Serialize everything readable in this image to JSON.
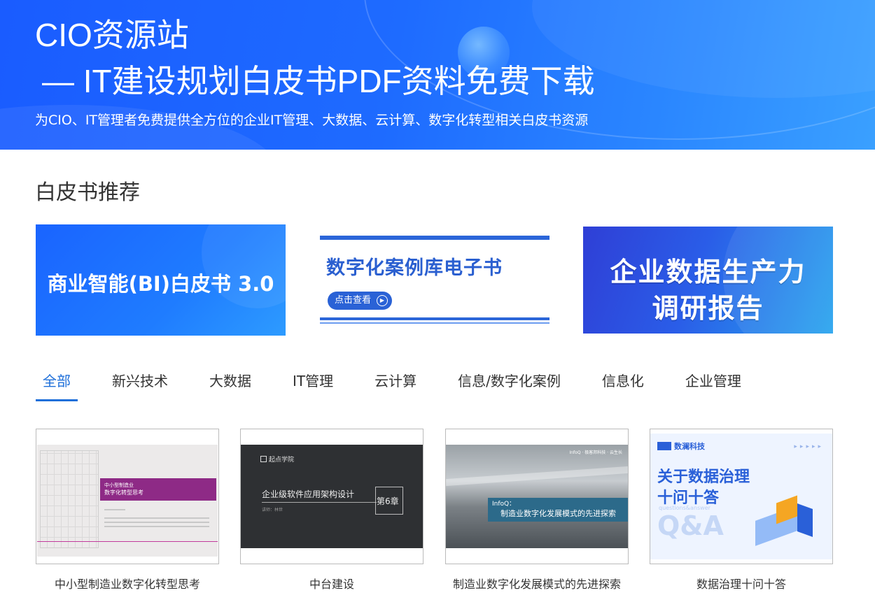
{
  "header": {
    "title_line1": "CIO资源站",
    "title_line2": "— IT建设规划白皮书PDF资料免费下载",
    "subtitle": "为CIO、IT管理者免费提供全方位的企业IT管理、大数据、云计算、数字化转型相关白皮书资源"
  },
  "section": {
    "title": "白皮书推荐"
  },
  "banners": [
    {
      "text": "商业智能(BI)白皮书 3.0"
    },
    {
      "text": "数字化案例库电子书",
      "button": "点击查看",
      "button_icon": "play-circle-icon"
    },
    {
      "line1": "企业数据生产力",
      "line2": "调研报告"
    }
  ],
  "tabs": [
    {
      "label": "全部",
      "active": true
    },
    {
      "label": "新兴技术"
    },
    {
      "label": "大数据"
    },
    {
      "label": "IT管理"
    },
    {
      "label": "云计算"
    },
    {
      "label": "信息/数字化案例"
    },
    {
      "label": "信息化"
    },
    {
      "label": "企业管理"
    }
  ],
  "cards": [
    {
      "caption": "中小型制造业数字化转型思考",
      "cover": {
        "small": "中小型制造业",
        "title": "数字化转型思考"
      }
    },
    {
      "caption": "中台建设",
      "cover": {
        "logo": "起点学院",
        "title": "企业级软件应用架构设计",
        "chapter": "第6章",
        "meta": "讲师：林世"
      }
    },
    {
      "caption": "制造业数字化发展模式的先进探索",
      "cover": {
        "kicker": "InfoQ：",
        "title": "制造业数字化发展模式的先进探索",
        "tag": "InfoQ · 极客邦科技 · 云生长"
      }
    },
    {
      "caption": "数据治理十问十答",
      "cover": {
        "brand": "数澜科技",
        "line1": "关于数据治理",
        "line2": "十问十答",
        "small": "questions&answer",
        "big": "Q&A"
      }
    }
  ],
  "colors": {
    "primary": "#1e6fd9",
    "hero": "#1a5cff"
  }
}
